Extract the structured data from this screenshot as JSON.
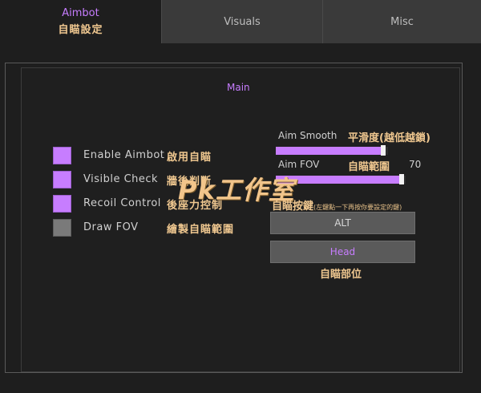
{
  "tabs": [
    {
      "label": "Aimbot",
      "sub": "自瞄設定"
    },
    {
      "label": "Visuals",
      "sub": ""
    },
    {
      "label": "Misc",
      "sub": ""
    }
  ],
  "section": {
    "title": "Main"
  },
  "checks": [
    {
      "label": "Enable Aimbot",
      "cn": "啟用自瞄",
      "checked": true
    },
    {
      "label": "Visible Check",
      "cn": "牆後判斷",
      "checked": true
    },
    {
      "label": "Recoil Control",
      "cn": "後座力控制",
      "checked": true
    },
    {
      "label": "Draw FOV",
      "cn": "繪製自瞄範圍",
      "checked": false
    }
  ],
  "sliders": {
    "smooth": {
      "label": "Aim Smooth",
      "cn": "平滑度(越低越鎖)",
      "fraction": 0.96
    },
    "fov": {
      "label": "Aim FOV",
      "cn": "自瞄範圍",
      "value": "70",
      "fraction": 0.97
    }
  },
  "keybind": {
    "label": "自瞄按鍵",
    "note": "(左鍵點一下再按你要設定的鍵)",
    "key": "ALT"
  },
  "bone": {
    "value": "Head",
    "label": "自瞄部位"
  },
  "watermark": "Pk工作室",
  "colors": {
    "accent": "#c77dff",
    "cn_text": "#f0c890"
  }
}
